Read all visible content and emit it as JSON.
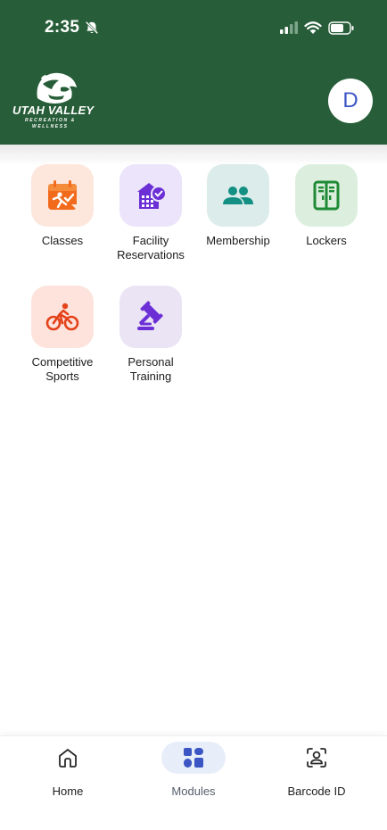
{
  "status_bar": {
    "time": "2:35"
  },
  "header": {
    "logo": {
      "title": "UTAH VALLEY",
      "subtitle_line1": "RECREATION &",
      "subtitle_line2": "WELLNESS"
    },
    "avatar_initial": "D"
  },
  "modules": [
    {
      "label": "Classes",
      "icon": "calendar-exercise-icon",
      "bg": "#fde6dc",
      "color": "#f26b1d"
    },
    {
      "label": "Facility Reservations",
      "icon": "building-check-icon",
      "bg": "#ebe4fa",
      "color": "#6c2fd6"
    },
    {
      "label": "Membership",
      "icon": "people-icon",
      "bg": "#dcecea",
      "color": "#138f83"
    },
    {
      "label": "Lockers",
      "icon": "locker-icon",
      "bg": "#dcefdf",
      "color": "#1f8a35"
    },
    {
      "label": "Competitive Sports",
      "icon": "cyclist-icon",
      "bg": "#fde3dc",
      "color": "#e4421a"
    },
    {
      "label": "Personal Training",
      "icon": "gavel-icon",
      "bg": "#ebe4f5",
      "color": "#6c2fd6"
    }
  ],
  "bottom_nav": {
    "items": [
      {
        "label": "Home",
        "icon": "home-icon"
      },
      {
        "label": "Modules",
        "icon": "grid-icon",
        "active": true
      },
      {
        "label": "Barcode ID",
        "icon": "face-scan-icon"
      }
    ]
  },
  "colors": {
    "header_bg": "#275d38",
    "avatar_text": "#3b56c4",
    "active_nav_bg": "#e7eefa",
    "active_nav_icon": "#3b56c4"
  }
}
